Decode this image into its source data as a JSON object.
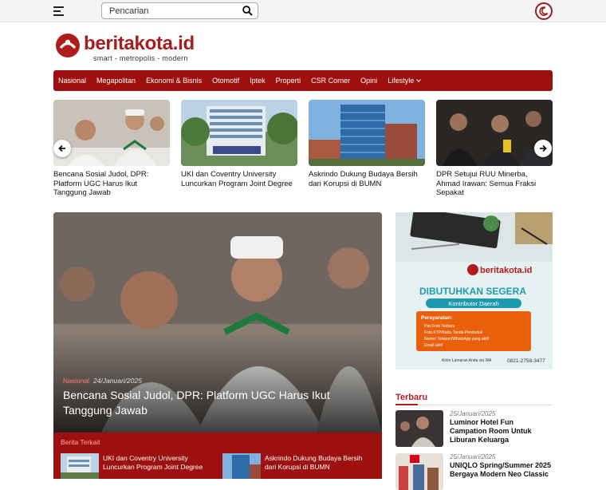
{
  "search": {
    "placeholder": "Pencarian"
  },
  "brand": {
    "name": "beritakota.id",
    "tagline": "smart - metropolis - modern"
  },
  "nav": {
    "items": [
      "Nasional",
      "Megapolitan",
      "Ekonomi & Bisnis",
      "Otomotif",
      "Iptek",
      "Properti",
      "CSR Corner",
      "Opini",
      "Lifestyle"
    ]
  },
  "slider": {
    "items": [
      {
        "title": "Bencana Sosial Judol, DPR: Platform UGC Harus Ikut Tanggung Jawab"
      },
      {
        "title": "UKI dan Coventry University Luncurkan Program Joint Degree"
      },
      {
        "title": "Askrindo Dukung Budaya Bersih dari Korupsi di BUMN"
      },
      {
        "title": "DPR Setujui RUU Minerba, Ahmad Irawan: Semua Fraksi Sepakat"
      }
    ]
  },
  "hero": {
    "category": "Nasional",
    "date": "24/Januari/2025",
    "title": "Bencana Sosial Judol, DPR: Platform UGC Harus Ikut Tanggung Jawab",
    "related_label": "Berita Terkait",
    "related": [
      {
        "title": "UKI dan Coventry University Luncurkan Program Joint Degree"
      },
      {
        "title": "Askrindo Dukung Budaya Bersih dari Korupsi di BUMN"
      }
    ]
  },
  "ad": {
    "brand": "beritakota.id",
    "headline": "DIBUTUHKAN SEGERA",
    "sub": "Kontributor Daerah",
    "req_title": "Persyaratan:",
    "reqs": [
      "Pas Foto Terbaru",
      "Foto KTP/Kartu Tanda Penduduk",
      "Nomor Telepon/WhatsApp yang aktif",
      "Email aktif"
    ],
    "footer": "Kirim Lamaran Anda via WA",
    "phone": "0821-2758-3477"
  },
  "terbaru": {
    "label": "Terbaru",
    "items": [
      {
        "date": "25/Januari/2025",
        "title": "Luminor Hotel Fun Campation Room Untuk Liburan Keluarga"
      },
      {
        "date": "25/Januari/2025",
        "title": "UNIQLO Spring/Summer 2025 Bergaya Modern Neo Classic"
      }
    ]
  },
  "colors": {
    "brand_red": "#9e0f0f",
    "accent": "#b01c1c"
  }
}
